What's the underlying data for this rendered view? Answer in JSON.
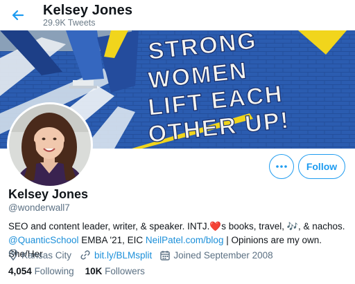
{
  "header": {
    "name": "Kelsey Jones",
    "tweet_count": "29.9K Tweets"
  },
  "banner": {
    "mural_lines": [
      "STRONG",
      "WOMEN",
      "LIFT EACH",
      "OTHER UP!"
    ]
  },
  "actions": {
    "more_label": "•••",
    "follow_label": "Follow"
  },
  "profile": {
    "name": "Kelsey Jones",
    "handle": "@wonderwall7",
    "bio": {
      "line1_a": "SEO and content leader, writer, & speaker. INTJ.",
      "heart": "❤️",
      "line1_b": "s books, travel, ",
      "music": "🎶",
      "line1_c": ", & nachos.",
      "mention": "@QuanticSchool",
      "line2_a": " EMBA '21, EIC ",
      "site_link": "NeilPatel.com/blog",
      "line2_b": " | Opinions are my own. She/Her"
    },
    "location": "Kansas City",
    "website": "bit.ly/BLMsplit",
    "joined": "Joined September 2008",
    "following_count": "4,054",
    "following_label": "Following",
    "followers_count": "10K",
    "followers_label": "Followers"
  },
  "colors": {
    "accent": "#1d9bf0",
    "link": "#1b8fd9",
    "muted": "#5b7083",
    "text": "#0f1419"
  },
  "icons": {
    "back": "arrow-left-icon",
    "more": "more-dots-icon",
    "location": "location-pin-icon",
    "website": "link-icon",
    "joined": "calendar-icon"
  }
}
